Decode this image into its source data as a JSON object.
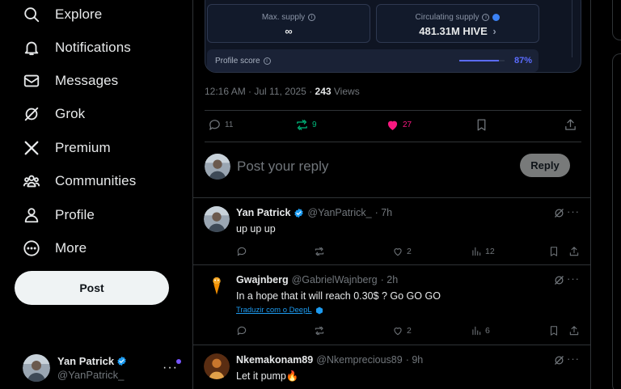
{
  "nav": {
    "items": [
      {
        "label": "Explore",
        "icon": "search-icon"
      },
      {
        "label": "Notifications",
        "icon": "bell-icon"
      },
      {
        "label": "Messages",
        "icon": "envelope-icon"
      },
      {
        "label": "Grok",
        "icon": "grok-icon"
      },
      {
        "label": "Premium",
        "icon": "x-logo-icon"
      },
      {
        "label": "Communities",
        "icon": "people-icon"
      },
      {
        "label": "Profile",
        "icon": "person-icon"
      },
      {
        "label": "More",
        "icon": "more-circle-icon"
      }
    ],
    "post_label": "Post"
  },
  "account": {
    "name": "Yan Patrick",
    "handle": "@YanPatrick_"
  },
  "card": {
    "max_supply_label": "Max. supply",
    "max_supply_value": "∞",
    "circ_supply_label": "Circulating supply",
    "circ_supply_value": "481.31M HIVE",
    "circ_chevron": "›",
    "profile_score_label": "Profile score",
    "profile_score_pct": "87%",
    "profile_score_fraction": 0.87
  },
  "tweet_meta": {
    "timestamp": "12:16 AM · Jul 11, 2025 · ",
    "views_count": "243",
    "views_label": " Views"
  },
  "tweet_actions": {
    "replies": "11",
    "reposts": "9",
    "likes": "27"
  },
  "reply_box": {
    "placeholder": "Post your reply",
    "button": "Reply"
  },
  "replies": [
    {
      "name": "Yan Patrick",
      "handle": "@YanPatrick_",
      "time": "· 7h",
      "text": "up up up",
      "replies": "",
      "reposts": "",
      "likes": "2",
      "views": "12"
    },
    {
      "name": "Gwajnberg",
      "handle": "@GabrielWajnberg",
      "time": "· 2h",
      "text": "In a hope that it will reach 0.30$ ? Go GO GO",
      "translate": "Traduzir com o DeepL",
      "replies": "",
      "reposts": "",
      "likes": "2",
      "views": "6"
    },
    {
      "name": "Nkemakonam89",
      "handle": "@Nkemprecious89",
      "time": "· 9h",
      "text": "Let it pump🔥"
    }
  ],
  "colors": {
    "like_active": "#f91880",
    "repost_active": "#00ba7c",
    "verified": "#1d9bf0",
    "score_accent": "#5b6cff"
  }
}
